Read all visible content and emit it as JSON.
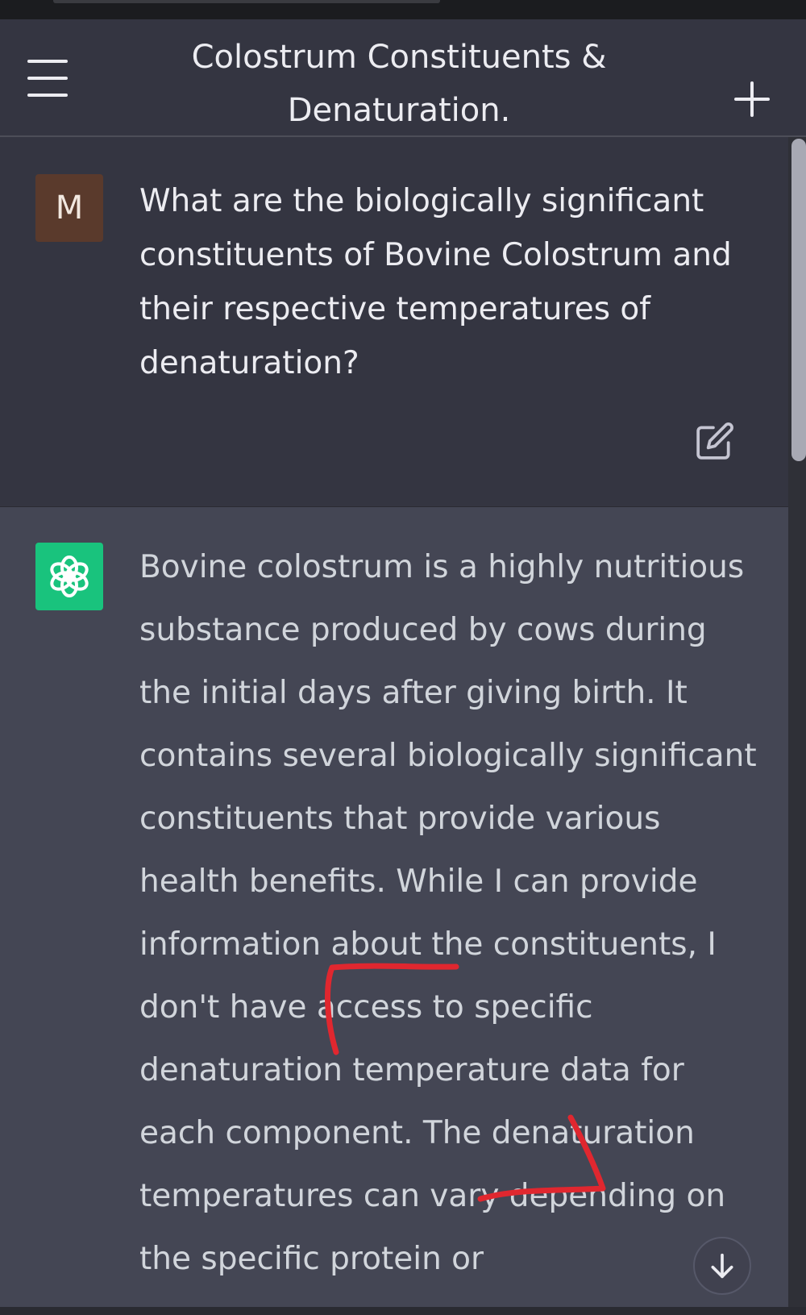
{
  "header": {
    "title_line1": "Colostrum Constituents &",
    "title_line2": "Denaturation.",
    "menu_icon": "hamburger-menu-icon",
    "new_chat_icon": "plus-icon"
  },
  "user_message": {
    "avatar_letter": "M",
    "avatar_color": "#5a3a2c",
    "text": "What are the biologically significant constituents of Bovine Colostrum and their respective temperatures of denaturation?",
    "edit_icon": "edit-icon"
  },
  "assistant_message": {
    "avatar_icon": "openai-logo-icon",
    "avatar_color": "#19c37d",
    "text": "Bovine colostrum is a highly nutritious substance produced by cows during the initial days after giving birth. It contains several biologically significant constituents that provide various health benefits. While I can provide information about the constituents, I don't have access to specific denaturation temperature data for each component. The denaturation temperatures can vary depending on the specific protein or"
  },
  "scroll_down_icon": "arrow-down-icon",
  "annotation_color": "#e0272f",
  "colors": {
    "background": "#343541",
    "assistant_background": "#444654",
    "text": "#ececf1"
  }
}
